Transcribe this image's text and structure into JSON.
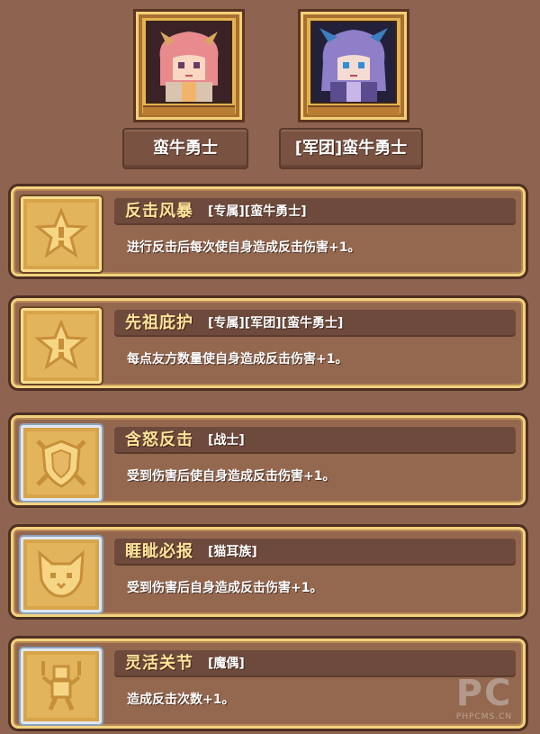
{
  "characters": [
    {
      "name": "蛮牛勇士",
      "portrait": "pink-haired-warrior-portrait"
    },
    {
      "name": "[军团]蛮牛勇士",
      "portrait": "purple-haired-warrior-portrait"
    }
  ],
  "skills": [
    {
      "name": "反击风暴",
      "tags": "[专属][蛮牛勇士]",
      "description": "进行反击后每次使自身造成反击伤害+1。",
      "icon": "star-icon",
      "frame": "gold"
    },
    {
      "name": "先祖庇护",
      "tags": "[专属][军团][蛮牛勇士]",
      "description": "每点友方数量使自身造成反击伤害+1。",
      "icon": "star-icon",
      "frame": "gold"
    },
    {
      "name": "含怒反击",
      "tags": "[战士]",
      "description": "受到伤害后使自身造成反击伤害+1。",
      "icon": "shield-swords-icon",
      "frame": "silver"
    },
    {
      "name": "睚眦必报",
      "tags": "[猫耳族]",
      "description": "受到伤害后自身造成反击伤害+1。",
      "icon": "cat-face-icon",
      "frame": "silver"
    },
    {
      "name": "灵活关节",
      "tags": "[魔偶]",
      "description": "造成反击次数+1。",
      "icon": "puppet-icon",
      "frame": "silver"
    }
  ],
  "watermark": {
    "big": "PC",
    "small": "PHPCMS.CN"
  },
  "colors": {
    "background": "#8e6450",
    "title": "#ffe49a",
    "frame_gold": "#f1d27f",
    "frame_silver": "#dfe8f2"
  }
}
